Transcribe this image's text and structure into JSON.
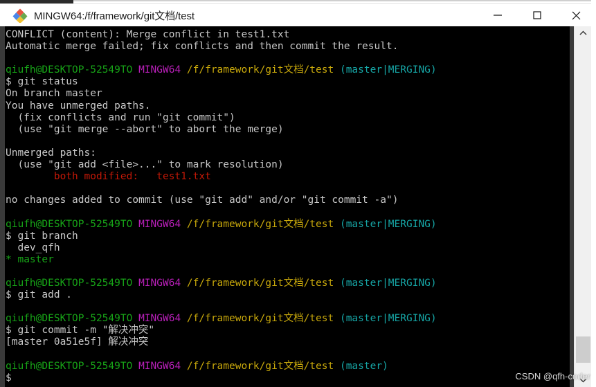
{
  "window": {
    "title": "MINGW64:/f/framework/git文档/test",
    "icon": "mingw-diamond-icon",
    "controls": {
      "minimize": "—",
      "maximize": "□",
      "close": "✕"
    }
  },
  "colors": {
    "terminal_background": "#000000",
    "default_text": "#c8c8c8",
    "user_host": "#17a317",
    "shell_name": "#b81fb8",
    "path": "#c9a90b",
    "branch": "#16a6a6",
    "conflict": "#c21807",
    "titlebar_background": "#ffffff"
  },
  "terminal": {
    "prompt_user": "qiufh@DESKTOP-52549TO",
    "prompt_shell": "MINGW64",
    "prompt_path": "/f/framework/git文档/test",
    "lines": [
      {
        "segments": [
          {
            "t": "CONFLICT (content): Merge conflict in test1.txt",
            "c": "c-default"
          }
        ]
      },
      {
        "segments": [
          {
            "t": "Automatic merge failed; fix conflicts and then commit the result.",
            "c": "c-default"
          }
        ]
      },
      {
        "segments": [
          {
            "t": "",
            "c": "c-default"
          }
        ]
      },
      {
        "segments": [
          {
            "t": "qiufh@DESKTOP-52549TO",
            "c": "c-green"
          },
          {
            "t": " ",
            "c": "c-default"
          },
          {
            "t": "MINGW64",
            "c": "c-purple"
          },
          {
            "t": " ",
            "c": "c-default"
          },
          {
            "t": "/f/framework/git文档/test",
            "c": "c-yellow"
          },
          {
            "t": " ",
            "c": "c-default"
          },
          {
            "t": "(master|MERGING)",
            "c": "c-cyan"
          }
        ]
      },
      {
        "segments": [
          {
            "t": "$ git status",
            "c": "c-default"
          }
        ]
      },
      {
        "segments": [
          {
            "t": "On branch master",
            "c": "c-default"
          }
        ]
      },
      {
        "segments": [
          {
            "t": "You have unmerged paths.",
            "c": "c-default"
          }
        ]
      },
      {
        "segments": [
          {
            "t": "  (fix conflicts and run \"git commit\")",
            "c": "c-default"
          }
        ]
      },
      {
        "segments": [
          {
            "t": "  (use \"git merge --abort\" to abort the merge)",
            "c": "c-default"
          }
        ]
      },
      {
        "segments": [
          {
            "t": "",
            "c": "c-default"
          }
        ]
      },
      {
        "segments": [
          {
            "t": "Unmerged paths:",
            "c": "c-default"
          }
        ]
      },
      {
        "segments": [
          {
            "t": "  (use \"git add <file>...\" to mark resolution)",
            "c": "c-default"
          }
        ]
      },
      {
        "segments": [
          {
            "t": "        both modified:   test1.txt",
            "c": "c-red"
          }
        ]
      },
      {
        "segments": [
          {
            "t": "",
            "c": "c-default"
          }
        ]
      },
      {
        "segments": [
          {
            "t": "no changes added to commit (use \"git add\" and/or \"git commit -a\")",
            "c": "c-default"
          }
        ]
      },
      {
        "segments": [
          {
            "t": "",
            "c": "c-default"
          }
        ]
      },
      {
        "segments": [
          {
            "t": "qiufh@DESKTOP-52549TO",
            "c": "c-green"
          },
          {
            "t": " ",
            "c": "c-default"
          },
          {
            "t": "MINGW64",
            "c": "c-purple"
          },
          {
            "t": " ",
            "c": "c-default"
          },
          {
            "t": "/f/framework/git文档/test",
            "c": "c-yellow"
          },
          {
            "t": " ",
            "c": "c-default"
          },
          {
            "t": "(master|MERGING)",
            "c": "c-cyan"
          }
        ]
      },
      {
        "segments": [
          {
            "t": "$ git branch",
            "c": "c-default"
          }
        ]
      },
      {
        "segments": [
          {
            "t": "  dev_qfh",
            "c": "c-default"
          }
        ]
      },
      {
        "segments": [
          {
            "t": "* master",
            "c": "c-green"
          }
        ]
      },
      {
        "segments": [
          {
            "t": "",
            "c": "c-default"
          }
        ]
      },
      {
        "segments": [
          {
            "t": "qiufh@DESKTOP-52549TO",
            "c": "c-green"
          },
          {
            "t": " ",
            "c": "c-default"
          },
          {
            "t": "MINGW64",
            "c": "c-purple"
          },
          {
            "t": " ",
            "c": "c-default"
          },
          {
            "t": "/f/framework/git文档/test",
            "c": "c-yellow"
          },
          {
            "t": " ",
            "c": "c-default"
          },
          {
            "t": "(master|MERGING)",
            "c": "c-cyan"
          }
        ]
      },
      {
        "segments": [
          {
            "t": "$ git add .",
            "c": "c-default"
          }
        ]
      },
      {
        "segments": [
          {
            "t": "",
            "c": "c-default"
          }
        ]
      },
      {
        "segments": [
          {
            "t": "qiufh@DESKTOP-52549TO",
            "c": "c-green"
          },
          {
            "t": " ",
            "c": "c-default"
          },
          {
            "t": "MINGW64",
            "c": "c-purple"
          },
          {
            "t": " ",
            "c": "c-default"
          },
          {
            "t": "/f/framework/git文档/test",
            "c": "c-yellow"
          },
          {
            "t": " ",
            "c": "c-default"
          },
          {
            "t": "(master|MERGING)",
            "c": "c-cyan"
          }
        ]
      },
      {
        "segments": [
          {
            "t": "$ git commit -m \"解决冲突\"",
            "c": "c-default"
          }
        ]
      },
      {
        "segments": [
          {
            "t": "[master 0a51e5f] 解决冲突",
            "c": "c-default"
          }
        ]
      },
      {
        "segments": [
          {
            "t": "",
            "c": "c-default"
          }
        ]
      },
      {
        "segments": [
          {
            "t": "qiufh@DESKTOP-52549TO",
            "c": "c-green"
          },
          {
            "t": " ",
            "c": "c-default"
          },
          {
            "t": "MINGW64",
            "c": "c-purple"
          },
          {
            "t": " ",
            "c": "c-default"
          },
          {
            "t": "/f/framework/git文档/test",
            "c": "c-yellow"
          },
          {
            "t": " ",
            "c": "c-default"
          },
          {
            "t": "(master)",
            "c": "c-cyan"
          }
        ]
      },
      {
        "segments": [
          {
            "t": "$",
            "c": "c-default"
          }
        ]
      }
    ]
  },
  "scrollbar": {
    "up_arrow": "▲",
    "down_arrow": "▼"
  },
  "watermark": {
    "text": "CSDN @qfh-coder"
  }
}
